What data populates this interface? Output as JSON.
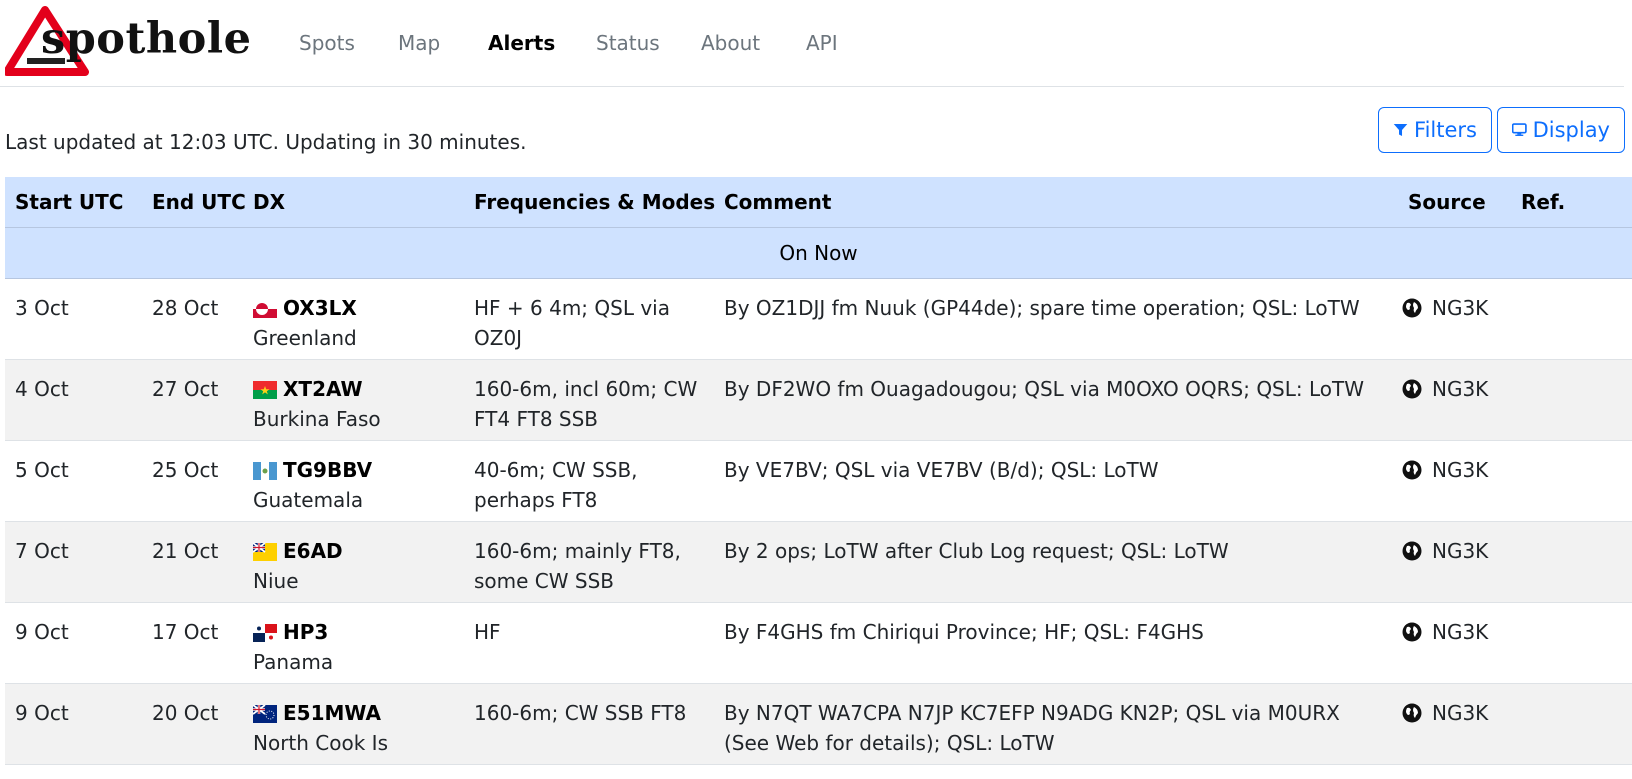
{
  "app": {
    "name": "spothole"
  },
  "nav": {
    "items": [
      "Spots",
      "Map",
      "Alerts",
      "Status",
      "About",
      "API"
    ],
    "active": "Alerts"
  },
  "status_text": "Last updated at 12:03 UTC. Updating in 30 minutes.",
  "buttons": {
    "filters": "Filters",
    "display": "Display"
  },
  "table": {
    "headers": [
      "Start UTC",
      "End UTC",
      "DX",
      "Frequencies & Modes",
      "Comment",
      "Source",
      "Ref."
    ],
    "group_label": "On Now",
    "rows": [
      {
        "start": "3 Oct",
        "end": "28 Oct",
        "flag": "greenland-flag-icon",
        "call": "OX3LX",
        "country": "Greenland",
        "freq": "HF + 6 4m; QSL via OZ0J",
        "comment": "By OZ1DJJ fm Nuuk (GP44de); spare time operation; QSL: LoTW",
        "source": "NG3K",
        "ref": ""
      },
      {
        "start": "4 Oct",
        "end": "27 Oct",
        "flag": "burkina-faso-flag-icon",
        "call": "XT2AW",
        "country": "Burkina Faso",
        "freq": "160-6m, incl 60m; CW FT4 FT8 SSB",
        "comment": "By DF2WO fm Ouagadougou; QSL via M0OXO OQRS; QSL: LoTW",
        "source": "NG3K",
        "ref": ""
      },
      {
        "start": "5 Oct",
        "end": "25 Oct",
        "flag": "guatemala-flag-icon",
        "call": "TG9BBV",
        "country": "Guatemala",
        "freq": "40-6m; CW SSB, perhaps FT8",
        "comment": "By VE7BV; QSL via VE7BV (B/d); QSL: LoTW",
        "source": "NG3K",
        "ref": ""
      },
      {
        "start": "7 Oct",
        "end": "21 Oct",
        "flag": "niue-flag-icon",
        "call": "E6AD",
        "country": "Niue",
        "freq": "160-6m; mainly FT8, some CW SSB",
        "comment": "By 2 ops; LoTW after Club Log request; QSL: LoTW",
        "source": "NG3K",
        "ref": ""
      },
      {
        "start": "9 Oct",
        "end": "17 Oct",
        "flag": "panama-flag-icon",
        "call": "HP3",
        "country": "Panama",
        "freq": "HF",
        "comment": "By F4GHS fm Chiriqui Province; HF; QSL: F4GHS",
        "source": "NG3K",
        "ref": ""
      },
      {
        "start": "9 Oct",
        "end": "20 Oct",
        "flag": "cook-islands-flag-icon",
        "call": "E51MWA",
        "country": "North Cook Is",
        "freq": "160-6m; CW SSB FT8",
        "comment": "By N7QT WA7CPA N7JP KC7EFP N9ADG KN2P; QSL via M0URX (See Web for details); QSL: LoTW",
        "source": "NG3K",
        "ref": ""
      }
    ]
  },
  "colors": {
    "accent": "#0d6efd",
    "header_bg": "#cfe2ff",
    "alt_row": "#f2f2f2",
    "logo_red": "#e3001b"
  }
}
